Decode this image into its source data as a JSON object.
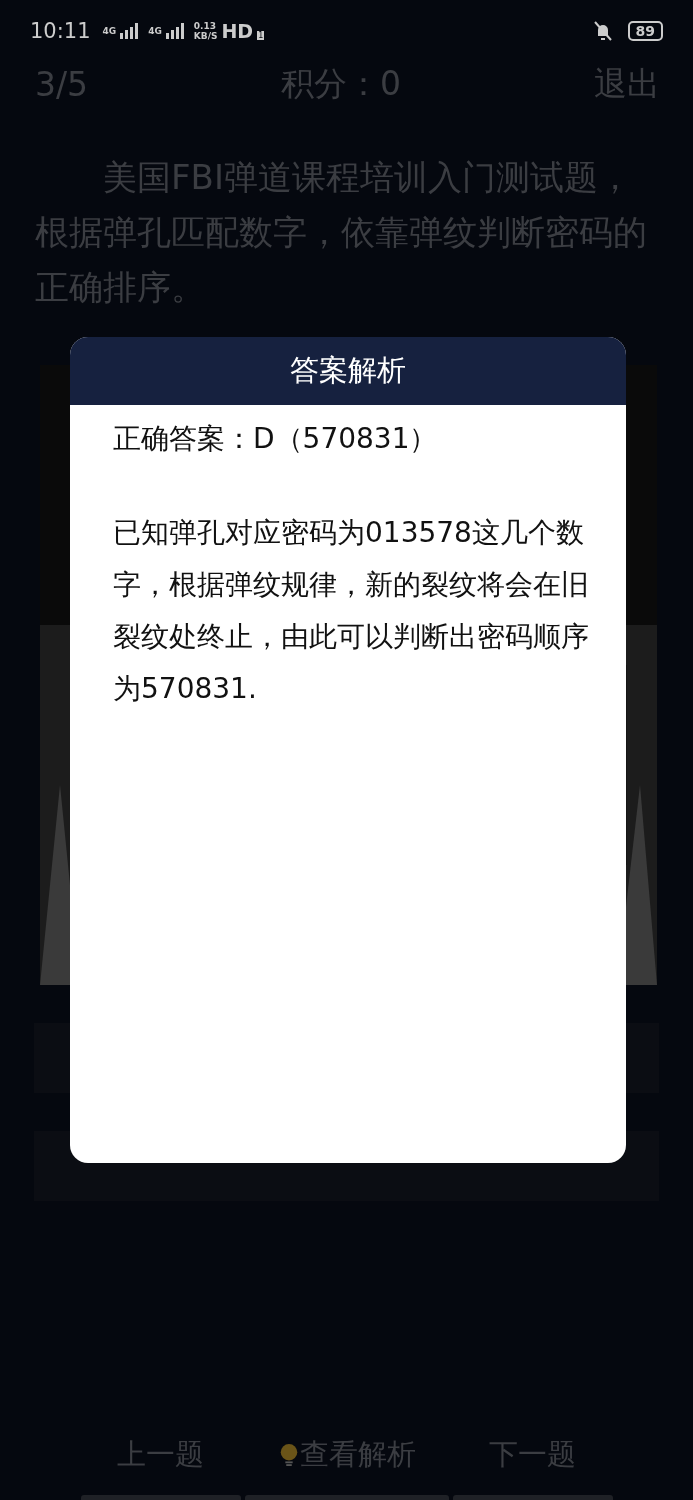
{
  "status_bar": {
    "time": "10:11",
    "network_1": "4G",
    "network_2": "4G",
    "speed_value": "0.13",
    "speed_unit": "KB/S",
    "hd": "HD",
    "hd_slot": "1",
    "battery": "89"
  },
  "header": {
    "progress": "3/5",
    "score": "积分：0",
    "exit": "退出"
  },
  "question": "美国FBI弹道课程培训入门测试题，根据弹孔匹配数字，依靠弹纹判断密码的正确排序。",
  "dialog": {
    "title": "答案解析",
    "answer": "正确答案：D（570831）",
    "explanation": "已知弹孔对应密码为013578这几个数字，根据弹纹规律，新的裂纹将会在旧裂纹处终止，由此可以判断出密码顺序为570831."
  },
  "buttons": [
    {
      "label": "上一题",
      "kind": "plain"
    },
    {
      "label": "查看解析",
      "kind": "hint"
    },
    {
      "label": "下一题",
      "kind": "plain"
    }
  ]
}
